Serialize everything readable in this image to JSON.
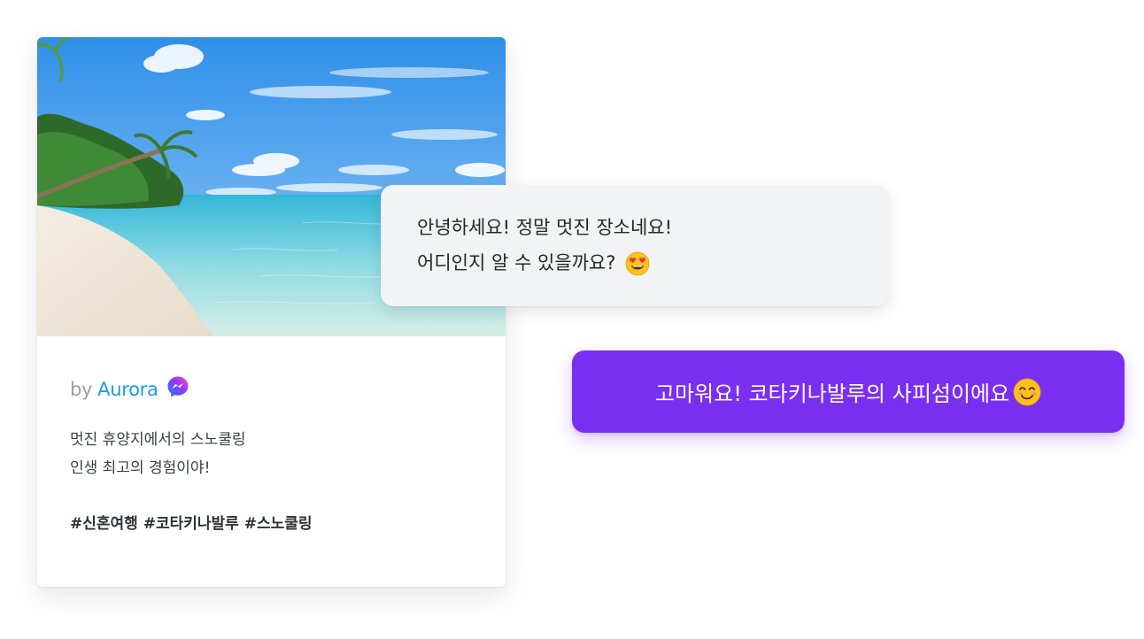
{
  "post": {
    "by_prefix": "by",
    "author": "Aurora",
    "caption_lines": [
      "멋진 휴양지에서의 스노쿨링",
      "인생 최고의 경험이야!"
    ],
    "hashtags": "#신혼여행 #코타키나발루 #스노쿨링",
    "photo_icon": "beach-photo",
    "author_icon": "messenger-icon"
  },
  "chat": {
    "incoming": {
      "line1": "안녕하세요! 정말 멋진 장소네요!",
      "line2": "어디인지 알 수 있을까요?",
      "emoji": "heart-eyes-emoji"
    },
    "outgoing": {
      "text": "고마워요! 코타키나발루의 사피섬이에요",
      "emoji": "smiling-face-emoji"
    }
  },
  "colors": {
    "author_link": "#1a9ce8",
    "messenger": "#8a2be2",
    "outgoing_bubble": "#7a2ff0",
    "incoming_bubble": "#f2f3f5"
  }
}
